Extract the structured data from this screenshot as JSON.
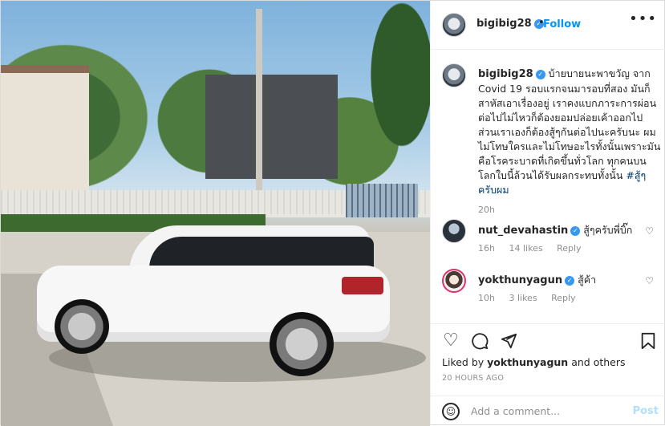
{
  "post": {
    "username": "bigibig28",
    "follow_label": "Follow",
    "separator": "•",
    "more_icon": "more-horizontal-icon"
  },
  "caption": {
    "username": "bigibig28",
    "text": "บ้ายบายนะพาขวัญ จาก Covid 19 รอบแรกจนมารอบที่สอง มันก็สาหัสเอาเรื่องอยู่ เราคงแบกภาระการผ่อนต่อไปไม่ไหวก็ต้องยอมปล่อยเค้าออกไป ส่วนเราเองก็ต้องสู้ๆกันต่อไปนะครับนะ ผมไม่โทษใครและไม่โทษอะไรทั้งนั้นเพราะมันคือโรคระบาดที่เกิดขึ้นทั่วโลก ทุกคนบนโลกใบนี้ล้วนได้รับผลกระทบทั้งนั้น",
    "hashtag": "#สู้ๆครับผม",
    "time": "20h"
  },
  "comments": [
    {
      "username": "nut_devahastin",
      "text": "สู้ๆครับพี่บิ๊ก",
      "time": "16h",
      "likes": "14 likes",
      "reply": "Reply"
    },
    {
      "username": "yokthunyagun",
      "text": "สู้ค้า",
      "time": "10h",
      "likes": "3 likes",
      "reply": "Reply"
    }
  ],
  "actions": {
    "liked_by_prefix": "Liked by",
    "liked_by_user": "yokthunyagun",
    "liked_by_suffix": "and others",
    "posted_ago": "20 HOURS AGO"
  },
  "add_comment": {
    "placeholder": "Add a comment...",
    "post_label": "Post"
  },
  "colors": {
    "link": "#0095f6",
    "verified": "#3897f0",
    "muted": "#8e8e8e",
    "hashtag": "#00376b"
  }
}
